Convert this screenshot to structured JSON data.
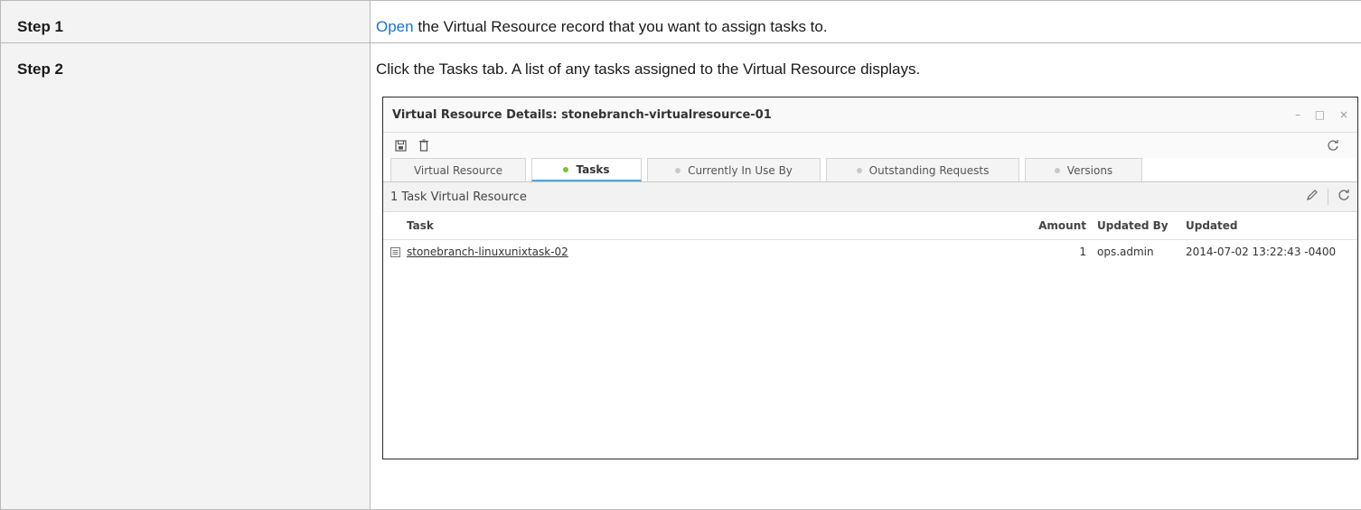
{
  "steps": [
    {
      "label": "Step 1",
      "link_text": "Open",
      "text_after_link": " the Virtual Resource record that you want to assign tasks to."
    },
    {
      "label": "Step 2",
      "text": "Click the Tasks tab. A list of any tasks assigned to the Virtual Resource displays."
    }
  ],
  "window": {
    "title": "Virtual Resource Details: stonebranch-virtualresource-01",
    "controls": [
      "–",
      "□",
      "×"
    ],
    "toolbar_icons": [
      "save-icon",
      "delete-icon",
      "refresh-icon"
    ],
    "tabs": [
      {
        "label": "Virtual Resource",
        "dot": false,
        "active": false
      },
      {
        "label": "Tasks",
        "dot": "green",
        "active": true
      },
      {
        "label": "Currently In Use By",
        "dot": "gray",
        "active": false
      },
      {
        "label": "Outstanding Requests",
        "dot": "gray",
        "active": false
      },
      {
        "label": "Versions",
        "dot": "gray",
        "active": false
      }
    ],
    "list_title": "1 Task Virtual Resource",
    "columns": [
      "Task",
      "Amount",
      "Updated By",
      "Updated"
    ],
    "rows": [
      {
        "task": "stonebranch-linuxunixtask-02",
        "amount": "1",
        "updated_by": "ops.admin",
        "updated": "2014-07-02 13:22:43 -0400"
      }
    ]
  },
  "colors": {
    "link": "#1a73c8",
    "active_tab_dot": "#7ac142",
    "active_tab_underline": "#5aa0d8"
  }
}
